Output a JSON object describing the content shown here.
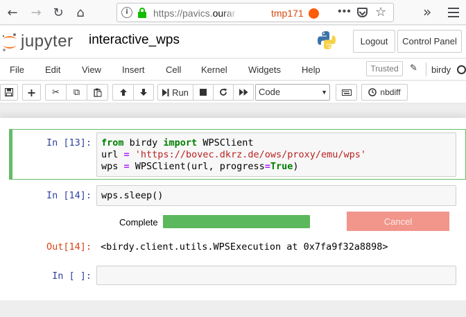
{
  "browser": {
    "url_scheme_path": "https://pavics.",
    "url_host": "ourano",
    "url_tag": "tmp171",
    "page_actions": "•••",
    "back_glyph": "←",
    "forward_glyph": "→",
    "reload_glyph": "↻",
    "home_glyph": "⌂",
    "star_glyph": "☆",
    "overflow_glyph": "»",
    "info_glyph": "i",
    "container_color": "#ff5c0a"
  },
  "header": {
    "logo_text": "jupyter",
    "notebook_name": "interactive_wps",
    "logout_label": "Logout",
    "control_panel_label": "Control Panel"
  },
  "menubar": {
    "items": [
      "File",
      "Edit",
      "View",
      "Insert",
      "Cell",
      "Kernel",
      "Widgets",
      "Help"
    ],
    "trusted_label": "Trusted",
    "kernel_name": "birdy",
    "pencil_glyph": "✎"
  },
  "toolbar": {
    "run_label": "Run",
    "cell_type": "Code",
    "nbdiff_label": "nbdiff",
    "glyphs": {
      "save": "💾",
      "add": "+",
      "cut": "✂",
      "copy": "⧉",
      "paste": "📋",
      "up": "⬆",
      "down": "⬇",
      "run": "▶",
      "stop": "■",
      "restart": "↻",
      "fast_forward": "⏩",
      "keyboard": "⌨",
      "clock": "⊙",
      "caret": "▼"
    }
  },
  "cells": [
    {
      "prompt": "In [13]:",
      "lines": [
        [
          {
            "t": "from",
            "c": "kw"
          },
          {
            "t": " birdy "
          },
          {
            "t": "import",
            "c": "kw"
          },
          {
            "t": " WPSClient"
          }
        ],
        [
          {
            "t": "url "
          },
          {
            "t": "=",
            "c": "op"
          },
          {
            "t": " "
          },
          {
            "t": "'https://bovec.dkrz.de/ows/proxy/emu/wps'",
            "c": "str"
          }
        ],
        [
          {
            "t": "wps "
          },
          {
            "t": "=",
            "c": "op"
          },
          {
            "t": " WPSClient(url, progress"
          },
          {
            "t": "=",
            "c": "op"
          },
          {
            "t": "True",
            "c": "kw"
          },
          {
            "t": ")"
          }
        ]
      ]
    },
    {
      "prompt": "In [14]:",
      "code": "wps.sleep()",
      "widget": {
        "label": "Complete",
        "progress": 1.0,
        "progress_color": "#5cb85c",
        "cancel_label": "Cancel",
        "cancel_color": "#f2958b"
      },
      "out_prompt": "Out[14]:",
      "output": "<birdy.client.utils.WPSExecution at 0x7fa9f32a8898>"
    },
    {
      "prompt": "In [ ]:",
      "code": ""
    }
  ],
  "colors": {
    "selected_cell_border": "#66bb6a",
    "in_prompt": "#303f9f",
    "out_prompt": "#d84315",
    "keyword": "#008000",
    "string": "#ba2121",
    "operator": "#aa22ff"
  }
}
